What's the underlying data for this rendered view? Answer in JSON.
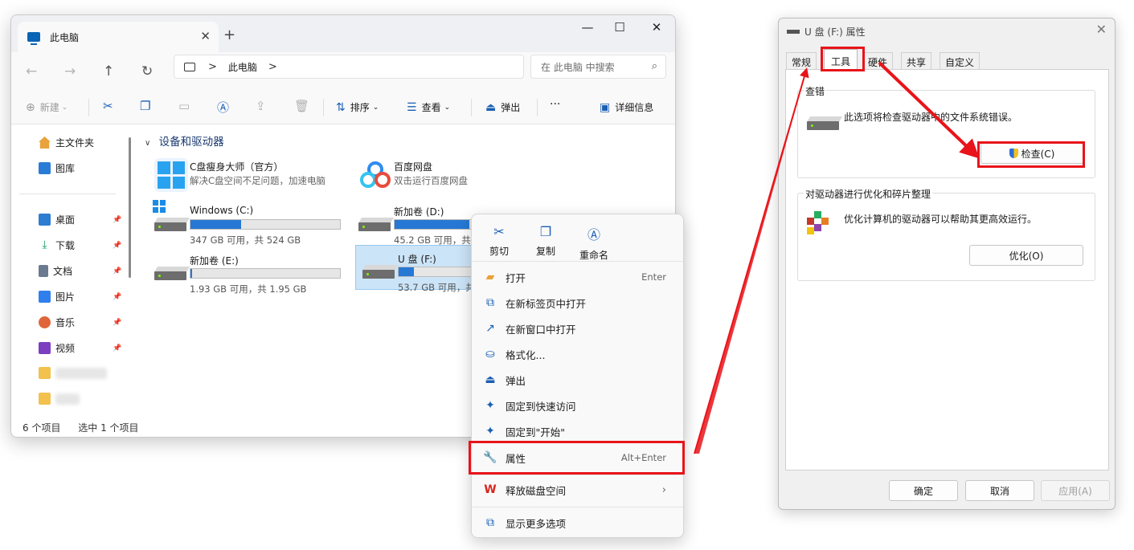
{
  "explorer": {
    "tab_title": "此电脑",
    "tab_close": "✕",
    "new_tab": "+",
    "window_controls": {
      "minimize": "—",
      "maximize": "☐",
      "close": "✕"
    },
    "address": {
      "path_label": "此电脑",
      "separator": ">",
      "trail": ">"
    },
    "search": {
      "placeholder": "在 此电脑 中搜索"
    },
    "toolbar": {
      "new_label": "新建",
      "sort_label": "排序",
      "view_label": "查看",
      "eject_label": "弹出",
      "more_label": "···",
      "details_label": "详细信息"
    },
    "sidebar": {
      "home": "主文件夹",
      "gallery": "图库",
      "items": [
        {
          "label": "桌面",
          "color": "#2d7dd2"
        },
        {
          "label": "下载",
          "color": "#1aa260"
        },
        {
          "label": "文档",
          "color": "#6b7a8f"
        },
        {
          "label": "图片",
          "color": "#2f80ed"
        },
        {
          "label": "音乐",
          "color": "#e0663a"
        },
        {
          "label": "视频",
          "color": "#7b3fbf"
        }
      ]
    },
    "section_title": "设备和驱动器",
    "drives": {
      "app1": {
        "name": "C盘瘦身大师（官方）",
        "desc": "解决C盘空间不足问题，加速电脑"
      },
      "app2": {
        "name": "百度网盘",
        "desc": "双击运行百度网盘"
      },
      "c": {
        "name": "Windows (C:)",
        "free": "347 GB 可用，共 524 GB",
        "used_fraction": 0.34
      },
      "d": {
        "name": "新加卷 (D:)",
        "free": "45.2 GB 可用，共",
        "used_fraction": 0.5
      },
      "e": {
        "name": "新加卷 (E:)",
        "free": "1.93 GB 可用，共 1.95 GB",
        "used_fraction": 0.01
      },
      "f": {
        "name": "U 盘 (F:)",
        "free": "53.7 GB 可用，共",
        "used_fraction": 0.1
      }
    },
    "status": {
      "count": "6 个项目",
      "selected": "选中 1 个项目"
    }
  },
  "context_menu": {
    "top_actions": {
      "cut": "剪切",
      "copy": "复制",
      "rename": "重命名"
    },
    "items": {
      "open": {
        "label": "打开",
        "shortcut": "Enter"
      },
      "open_new_tab": {
        "label": "在新标签页中打开"
      },
      "open_new_window": {
        "label": "在新窗口中打开"
      },
      "format": {
        "label": "格式化..."
      },
      "eject": {
        "label": "弹出"
      },
      "pin_quick": {
        "label": "固定到快速访问"
      },
      "pin_start": {
        "label": "固定到\"开始\""
      },
      "properties": {
        "label": "属性",
        "shortcut": "Alt+Enter"
      },
      "free_space": {
        "label": "释放磁盘空间"
      },
      "more_options": {
        "label": "显示更多选项"
      }
    }
  },
  "properties_dialog": {
    "title": "U 盘 (F:) 属性",
    "close": "✕",
    "tabs": {
      "general": "常规",
      "tools": "工具",
      "hardware": "硬件",
      "sharing": "共享",
      "custom": "自定义"
    },
    "check_group": {
      "label": "查错",
      "text": "此选项将检查驱动器中的文件系统错误。",
      "button": "检查(C)"
    },
    "optimize_group": {
      "label": "对驱动器进行优化和碎片整理",
      "text": "优化计算机的驱动器可以帮助其更高效运行。",
      "button": "优化(O)"
    },
    "buttons": {
      "ok": "确定",
      "cancel": "取消",
      "apply": "应用(A)"
    }
  },
  "colors": {
    "highlight": "#e8141a",
    "accent": "#2678d4"
  }
}
